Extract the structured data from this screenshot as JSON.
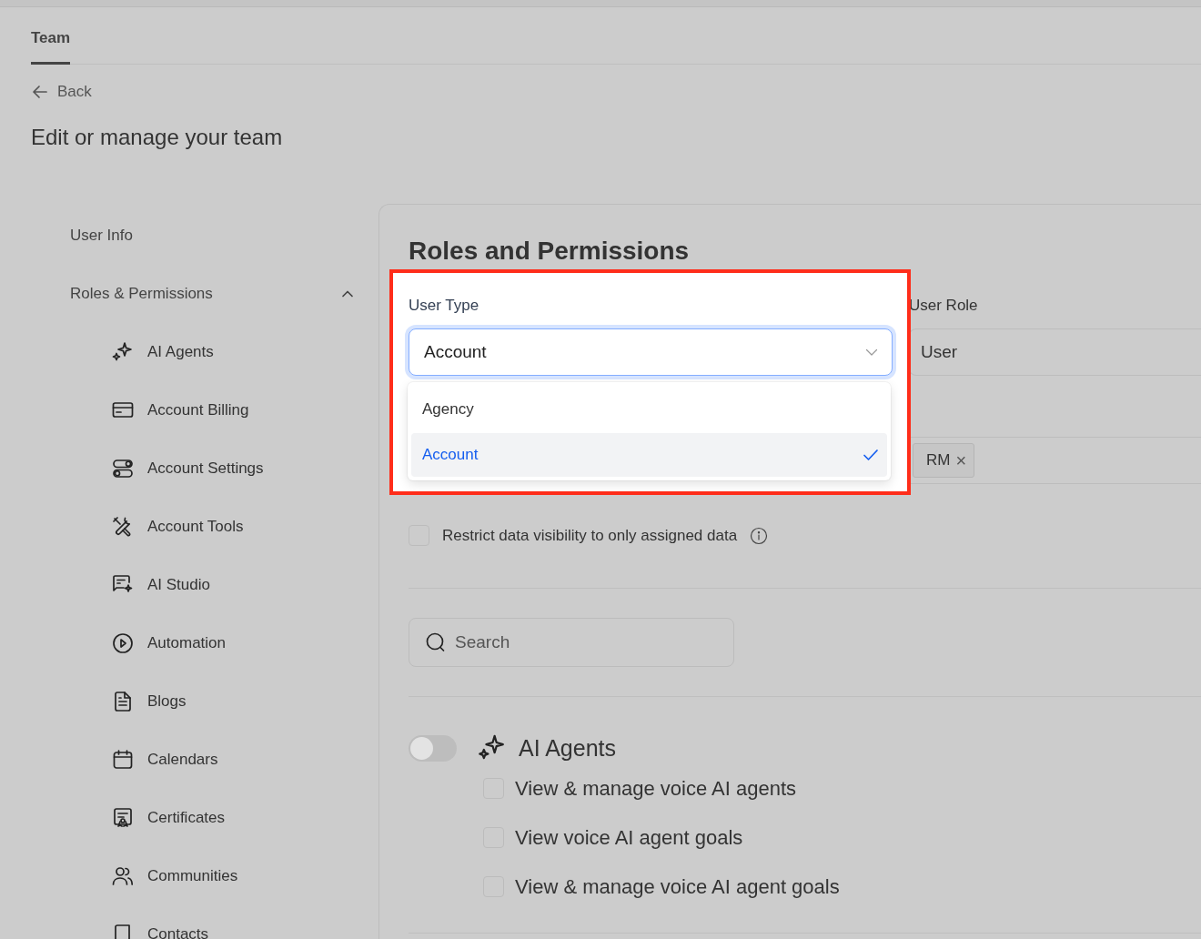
{
  "tabs": [
    {
      "label": "Team",
      "selected": true
    }
  ],
  "back_link": "Back",
  "page_title": "Edit or manage your team",
  "sidebar": {
    "items": [
      {
        "label": "User Info"
      },
      {
        "label": "Roles & Permissions",
        "expanded": true,
        "children": [
          {
            "label": "AI Agents"
          },
          {
            "label": "Account Billing"
          },
          {
            "label": "Account Settings"
          },
          {
            "label": "Account Tools"
          },
          {
            "label": "AI Studio"
          },
          {
            "label": "Automation"
          },
          {
            "label": "Blogs"
          },
          {
            "label": "Calendars"
          },
          {
            "label": "Certificates"
          },
          {
            "label": "Communities"
          },
          {
            "label": "Contacts"
          }
        ]
      }
    ]
  },
  "panel": {
    "title": "Roles and Permissions",
    "user_type": {
      "label": "User Type",
      "value": "Account",
      "open": true,
      "options": [
        {
          "label": "Agency",
          "selected": false
        },
        {
          "label": "Account",
          "selected": true
        }
      ]
    },
    "user_role": {
      "label": "User Role",
      "value": "User"
    },
    "field_3": {
      "tags": [
        {
          "label": "RM",
          "remove": "×"
        }
      ]
    },
    "restrict_checkbox": {
      "label": "Restrict data visibility to only assigned data",
      "checked": false
    },
    "search": {
      "placeholder": "Search"
    },
    "permission_groups": [
      {
        "title": "AI Agents",
        "on": false,
        "permissions": [
          {
            "label": "View & manage voice AI agents",
            "checked": false
          },
          {
            "label": "View voice AI agent goals",
            "checked": false
          },
          {
            "label": "View & manage voice AI agent goals",
            "checked": false
          }
        ]
      }
    ]
  }
}
